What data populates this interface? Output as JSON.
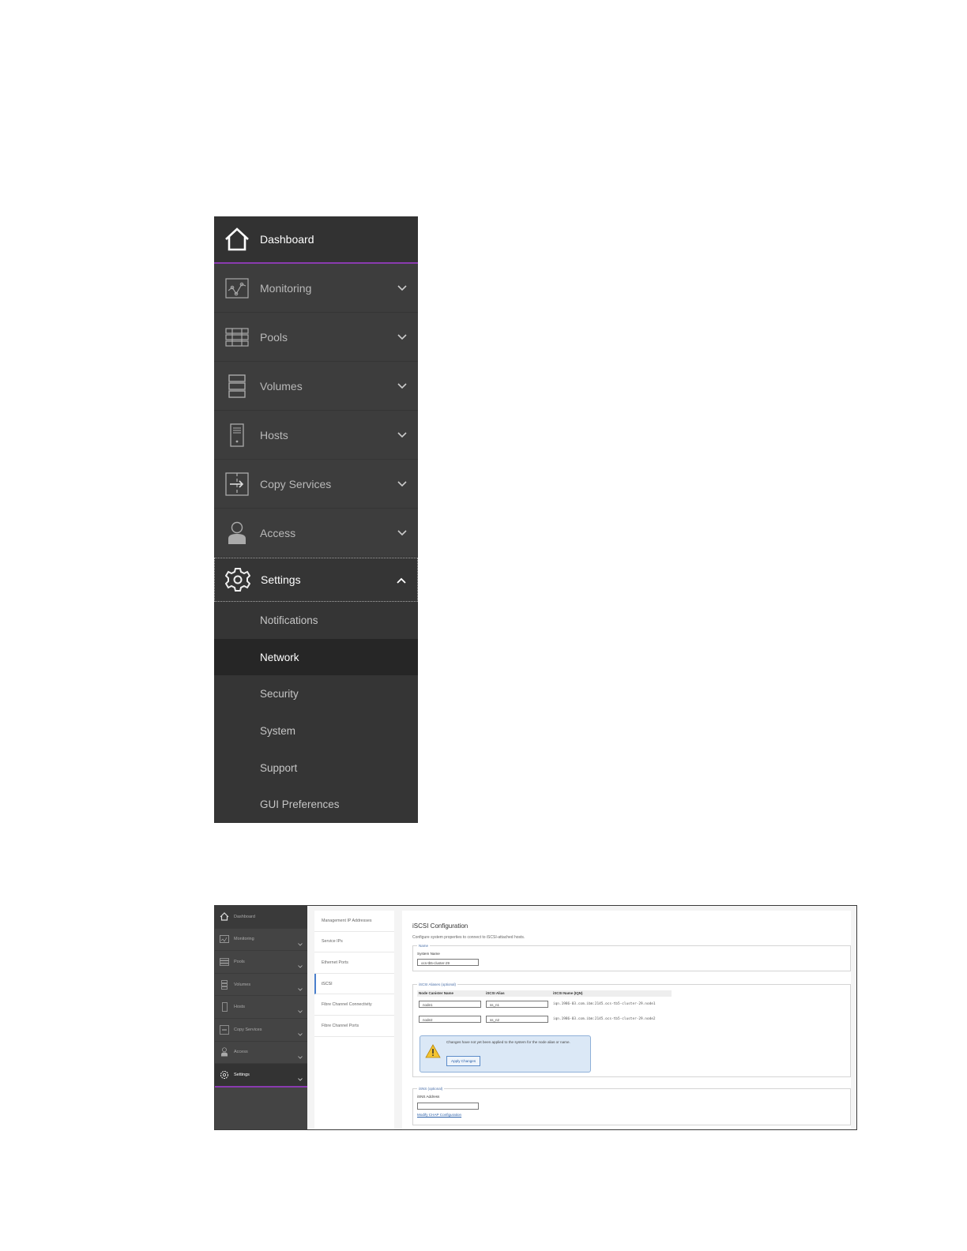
{
  "nav": {
    "dashboard": "Dashboard",
    "items": [
      {
        "label": "Monitoring",
        "icon": "monitoring-icon"
      },
      {
        "label": "Pools",
        "icon": "pools-icon"
      },
      {
        "label": "Volumes",
        "icon": "volumes-icon"
      },
      {
        "label": "Hosts",
        "icon": "hosts-icon"
      },
      {
        "label": "Copy Services",
        "icon": "copy-services-icon"
      },
      {
        "label": "Access",
        "icon": "access-icon"
      }
    ],
    "settings": "Settings",
    "settings_sub": [
      "Notifications",
      "Network",
      "Security",
      "System",
      "Support",
      "GUI Preferences"
    ],
    "active_sub": "Network"
  },
  "screenshot": {
    "nav": [
      "Dashboard",
      "Monitoring",
      "Pools",
      "Volumes",
      "Hosts",
      "Copy Services",
      "Access",
      "Settings"
    ],
    "subnav": [
      "Management IP Addresses",
      "Service IPs",
      "Ethernet Ports",
      "iSCSI",
      "Fibre Channel Connectivity",
      "Fibre Channel Ports"
    ],
    "active_subnav": "iSCSI",
    "title": "iSCSI Configuration",
    "description": "Configure system properties to connect to iSCSI-attached hosts.",
    "name_legend": "Name",
    "system_name_label": "System Name",
    "system_name_value": "ocs-tb5-cluster-29",
    "aliases_legend": "iSCSI Aliases (optional)",
    "col_node": "Node Canister Name",
    "col_alias": "iSCSI Alias",
    "col_iqn": "iSCSI Name (IQN)",
    "rows": [
      {
        "node": "node1",
        "alias": "ss_n1",
        "iqn": "iqn.1986-03.com.ibm:2145.ocs-tb5-cluster-29.node1"
      },
      {
        "node": "node2",
        "alias": "ss_n2",
        "iqn": "iqn.1986-03.com.ibm:2145.ocs-tb5-cluster-29.node2"
      }
    ],
    "warning_text": "Changes have not yet been applied to the system for the node alias or name.",
    "apply_button": "Apply Changes",
    "isns_legend": "iSNS (optional)",
    "isns_label": "iSNS Address",
    "chap_link": "Modify CHAP Configuration"
  }
}
